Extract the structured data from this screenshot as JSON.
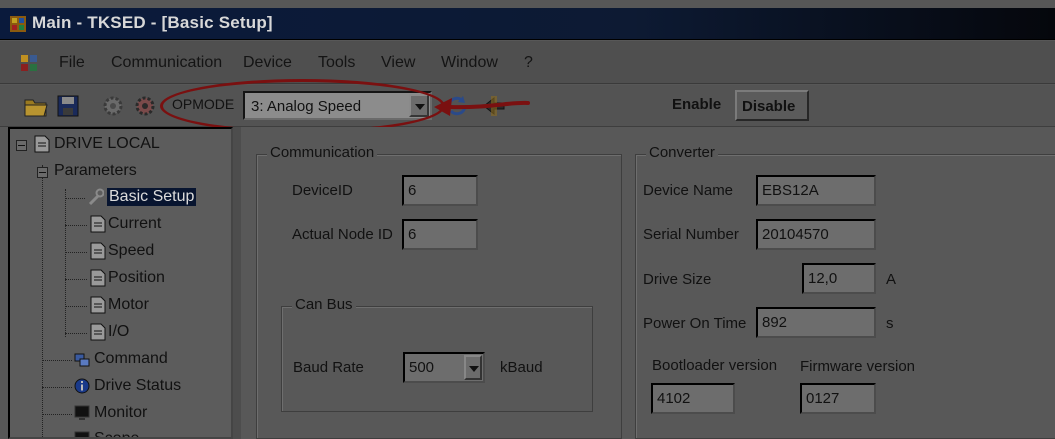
{
  "window": {
    "title": "Main - TKSED - [Basic Setup]"
  },
  "menu": {
    "items": [
      "File",
      "Communication",
      "Device",
      "Tools",
      "View",
      "Window",
      "?"
    ]
  },
  "toolbar": {
    "opmode_label": "OPMODE",
    "opmode_value": "3: Analog Speed",
    "enable_label": "Enable",
    "disable_label": "Disable"
  },
  "tree": {
    "root": "DRIVE LOCAL",
    "parameters": "Parameters",
    "children": [
      "Basic Setup",
      "Current",
      "Speed",
      "Position",
      "Motor",
      "I/O"
    ],
    "command": "Command",
    "drive_status": "Drive Status",
    "monitor": "Monitor",
    "scope": "Scope"
  },
  "communication": {
    "title": "Communication",
    "device_id_label": "DeviceID",
    "device_id_value": "6",
    "actual_node_id_label": "Actual Node ID",
    "actual_node_id_value": "6",
    "canbus": {
      "title": "Can Bus",
      "baud_rate_label": "Baud Rate",
      "baud_rate_value": "500",
      "baud_unit": "kBaud"
    }
  },
  "converter": {
    "title": "Converter",
    "device_name_label": "Device Name",
    "device_name_value": "EBS12A",
    "serial_number_label": "Serial Number",
    "serial_number_value": "20104570",
    "drive_size_label": "Drive Size",
    "drive_size_value": "12,0",
    "drive_size_unit": "A",
    "power_on_time_label": "Power On Time",
    "power_on_time_value": "892",
    "power_on_time_unit": "s",
    "bootloader_label": "Bootloader version",
    "bootloader_value": "4102",
    "firmware_label": "Firmware version",
    "firmware_value": "0127"
  },
  "colors": {
    "annotation": "#7a1010",
    "selection": "#081530"
  }
}
